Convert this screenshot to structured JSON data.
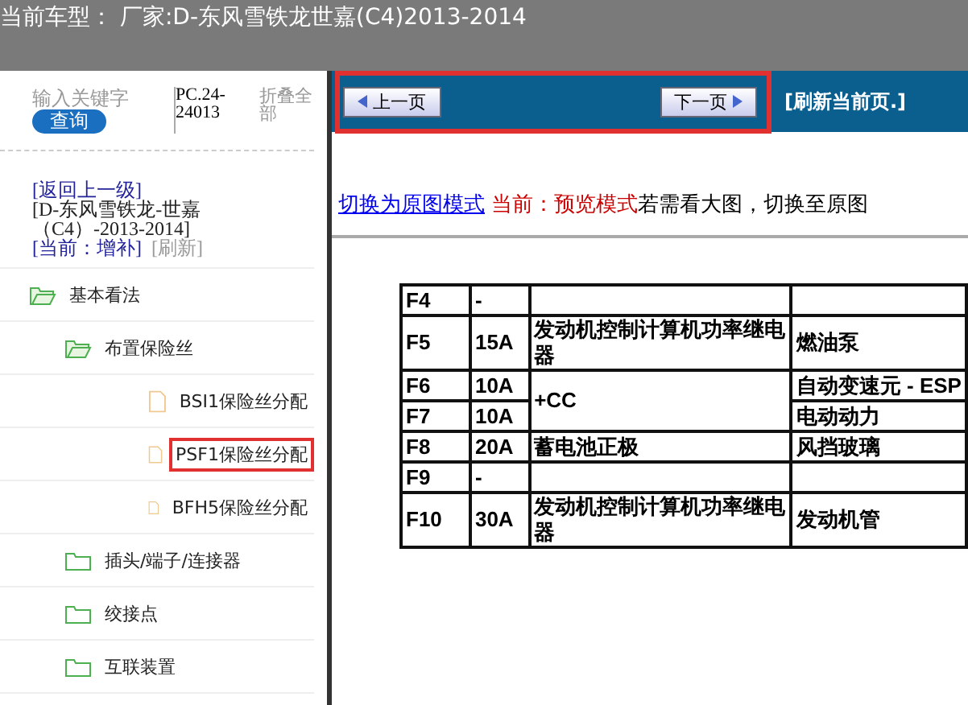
{
  "window": {
    "title": "当前车型：  厂家:D-东风雪铁龙世嘉(C4)2013-2014"
  },
  "sidebar": {
    "search": {
      "placeholder": "输入关键字",
      "button": "查询"
    },
    "code": "PC.24-24013",
    "collapse_all": "折叠全部",
    "back_link": "[返回上一级]",
    "path": "[D-东风雪铁龙-世嘉（C4）-2013-2014]",
    "current": "[当前：增补]",
    "refresh": "[刷新]",
    "tree": [
      {
        "kind": "folder",
        "label": "基本看法",
        "expanded": true,
        "highlighted": false,
        "children": [
          {
            "kind": "folder",
            "label": "布置保险丝",
            "expanded": true,
            "highlighted": false,
            "children": [
              {
                "kind": "file",
                "label": "BSI1保险丝分配",
                "highlighted": false
              },
              {
                "kind": "file",
                "label": "PSF1保险丝分配",
                "highlighted": true
              },
              {
                "kind": "file",
                "label": "BFH5保险丝分配",
                "highlighted": false
              }
            ]
          },
          {
            "kind": "folder",
            "label": "插头/端子/连接器",
            "expanded": false,
            "highlighted": false
          },
          {
            "kind": "folder",
            "label": "绞接点",
            "expanded": false,
            "highlighted": false
          },
          {
            "kind": "folder",
            "label": "互联装置",
            "expanded": false,
            "highlighted": false
          }
        ]
      }
    ]
  },
  "toolbar": {
    "prev": "上一页",
    "next": "下一页",
    "refresh": "[刷新当前页.]",
    "highlighted": true
  },
  "mode_bar": {
    "link": "切换为原图模式",
    "current": "当前：预览模式",
    "hint": "若需看大图，切换至原图"
  },
  "table": {
    "rows": [
      {
        "cells": [
          {
            "text": "F4"
          },
          {
            "text": "-"
          },
          {
            "text": ""
          },
          {
            "text": ""
          }
        ]
      },
      {
        "cells": [
          {
            "text": "F5"
          },
          {
            "text": "15A"
          },
          {
            "text": "发动机控制计算机功率继电器"
          },
          {
            "text": "燃油泵"
          }
        ]
      },
      {
        "cells": [
          {
            "text": "F6"
          },
          {
            "text": "10A"
          },
          {
            "text": "+CC",
            "rowspan": 2
          },
          {
            "text": "自动变速元 - ESP"
          }
        ]
      },
      {
        "cells": [
          {
            "text": "F7"
          },
          {
            "text": "10A"
          },
          {
            "text": "电动动力"
          }
        ]
      },
      {
        "cells": [
          {
            "text": "F8"
          },
          {
            "text": "20A"
          },
          {
            "text": "蓄电池正极"
          },
          {
            "text": "风挡玻璃"
          }
        ]
      },
      {
        "cells": [
          {
            "text": "F9"
          },
          {
            "text": "-"
          },
          {
            "text": ""
          },
          {
            "text": ""
          }
        ]
      },
      {
        "cells": [
          {
            "text": "F10"
          },
          {
            "text": "30A"
          },
          {
            "text": "发动机控制计算机功率继电器"
          },
          {
            "text": "发动机管"
          }
        ]
      }
    ]
  }
}
